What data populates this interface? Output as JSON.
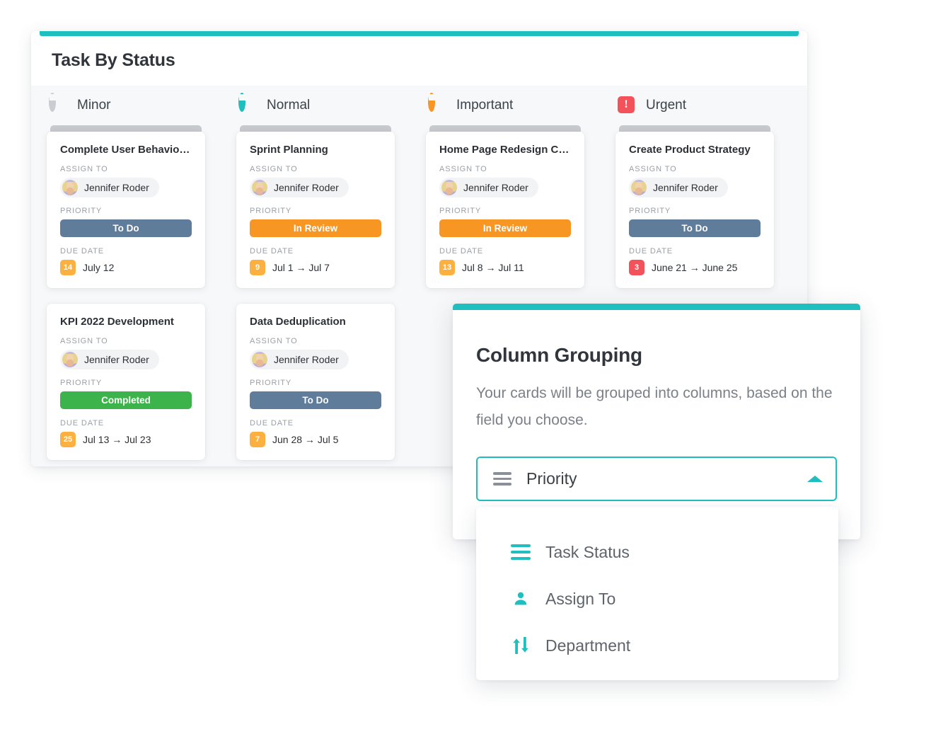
{
  "board": {
    "title": "Task By Status",
    "columns": [
      {
        "label": "Minor",
        "icon": "ring-gray-icon",
        "cards": [
          {
            "title": "Complete User Behavior An...",
            "assign_label": "ASSIGN TO",
            "assignee": "Jennifer Roder",
            "priority_label": "PRIORITY",
            "priority": "To Do",
            "priority_color": "#5f7c9b",
            "due_label": "DUE DATE",
            "due_chip": "14",
            "due_chip_color": "#fbb040",
            "due_text": "July 12"
          },
          {
            "title": "KPI 2022 Development",
            "assign_label": "ASSIGN TO",
            "assignee": "Jennifer Roder",
            "priority_label": "PRIORITY",
            "priority": "Completed",
            "priority_color": "#3cb44b",
            "due_label": "DUE DATE",
            "due_chip": "25",
            "due_chip_color": "#fbb040",
            "due_text": "Jul 13 → Jul 23"
          }
        ]
      },
      {
        "label": "Normal",
        "icon": "ring-teal-icon",
        "cards": [
          {
            "title": "Sprint Planning",
            "assign_label": "ASSIGN TO",
            "assignee": "Jennifer Roder",
            "priority_label": "PRIORITY",
            "priority": "In Review",
            "priority_color": "#f79622",
            "due_label": "DUE DATE",
            "due_chip": "9",
            "due_chip_color": "#fbb040",
            "due_text": "Jul 1 → Jul 7"
          },
          {
            "title": "Data Deduplication",
            "assign_label": "ASSIGN TO",
            "assignee": "Jennifer Roder",
            "priority_label": "PRIORITY",
            "priority": "To Do",
            "priority_color": "#5f7c9b",
            "due_label": "DUE DATE",
            "due_chip": "7",
            "due_chip_color": "#fbb040",
            "due_text": "Jun 28 → Jul 5"
          }
        ]
      },
      {
        "label": "Important",
        "icon": "ring-orange-icon",
        "cards": [
          {
            "title": "Home Page Redesign Conce...",
            "assign_label": "ASSIGN TO",
            "assignee": "Jennifer Roder",
            "priority_label": "PRIORITY",
            "priority": "In Review",
            "priority_color": "#f79622",
            "due_label": "DUE DATE",
            "due_chip": "13",
            "due_chip_color": "#fbb040",
            "due_text": "Jul 8 → Jul 11"
          }
        ]
      },
      {
        "label": "Urgent",
        "icon": "exclamation-badge-icon",
        "exclamation": "!",
        "cards": [
          {
            "title": "Create Product Strategy",
            "assign_label": "ASSIGN TO",
            "assignee": "Jennifer Roder",
            "priority_label": "PRIORITY",
            "priority": "To Do",
            "priority_color": "#5f7c9b",
            "due_label": "DUE DATE",
            "due_chip": "3",
            "due_chip_color": "#f4525a",
            "due_text": "June 21 → June 25"
          }
        ]
      }
    ]
  },
  "grouping": {
    "title": "Column Grouping",
    "description": "Your cards will be grouped into columns, based on the field you choose.",
    "select": {
      "value": "Priority",
      "icon": "list-lines-icon",
      "caret": "chevron-up-icon"
    },
    "options": [
      {
        "label": "Task Status",
        "icon": "list-lines-icon"
      },
      {
        "label": "Assign To",
        "icon": "person-icon"
      },
      {
        "label": "Department",
        "icon": "exchange-arrows-icon"
      }
    ]
  },
  "colors": {
    "accent": "#1fbfc0",
    "todo": "#5f7c9b",
    "in_review": "#f79622",
    "completed": "#3cb44b",
    "urgent": "#f4525a",
    "amber": "#fbb040"
  }
}
